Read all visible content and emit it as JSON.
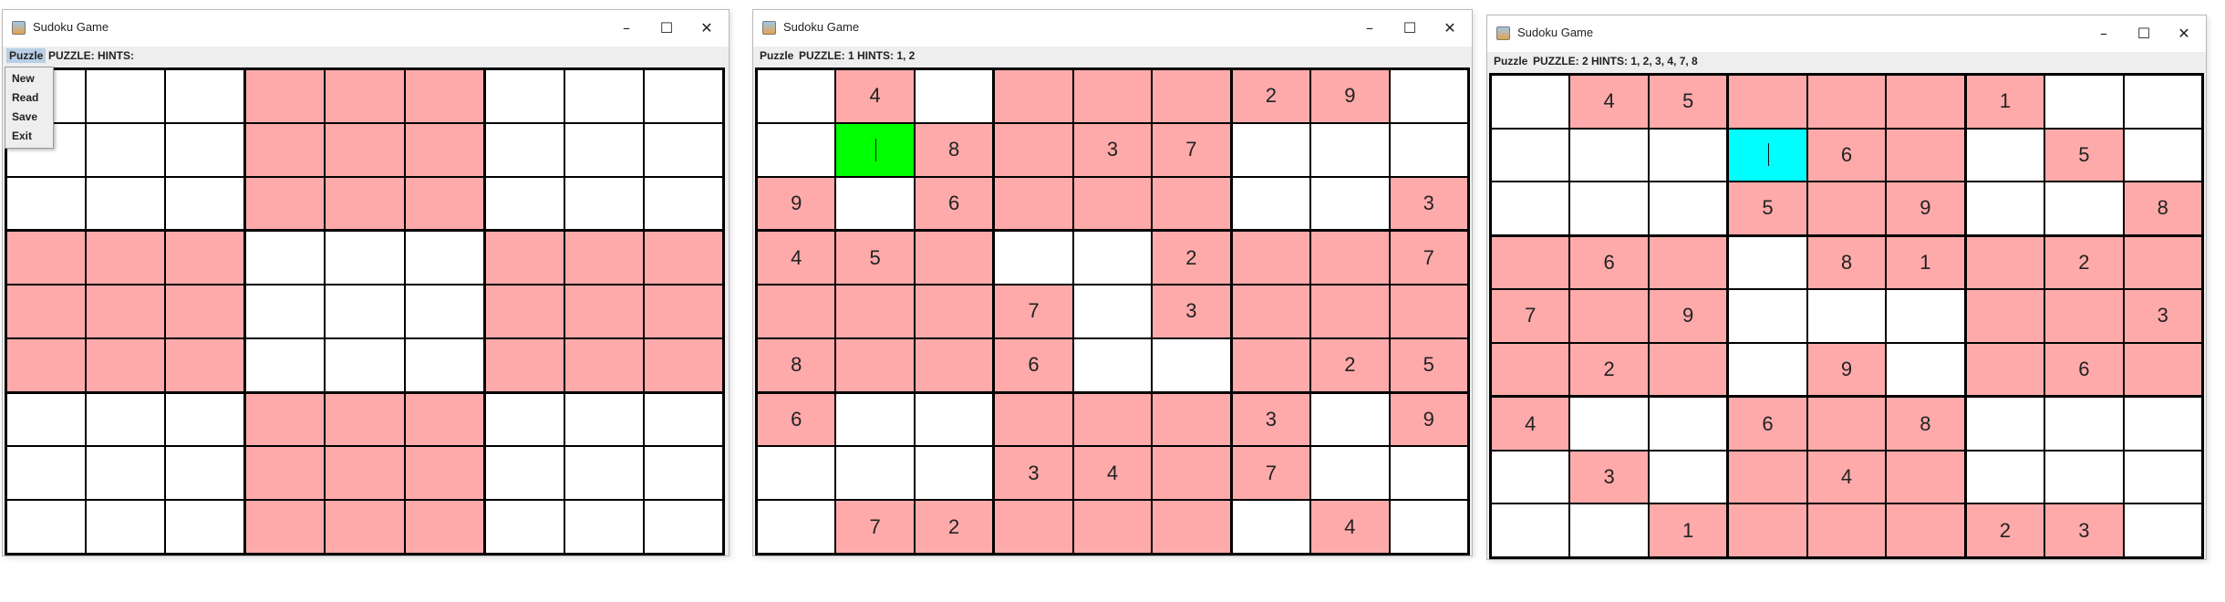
{
  "windows": [
    {
      "title": "Sudoku Game",
      "menu_label": "Puzzle",
      "info_text": "PUZZLE:  HINTS:",
      "menu_open": true,
      "menu_items": [
        "New",
        "Read",
        "Save",
        "Exit"
      ],
      "selected_cell": null,
      "selected_color": null,
      "pink_boxes": [
        1,
        3,
        5,
        7
      ],
      "grid": [
        [
          "",
          "",
          "",
          "",
          "",
          "",
          "",
          "",
          ""
        ],
        [
          "",
          "",
          "",
          "",
          "",
          "",
          "",
          "",
          ""
        ],
        [
          "",
          "",
          "",
          "",
          "",
          "",
          "",
          "",
          ""
        ],
        [
          "",
          "",
          "",
          "",
          "",
          "",
          "",
          "",
          ""
        ],
        [
          "",
          "",
          "",
          "",
          "",
          "",
          "",
          "",
          ""
        ],
        [
          "",
          "",
          "",
          "",
          "",
          "",
          "",
          "",
          ""
        ],
        [
          "",
          "",
          "",
          "",
          "",
          "",
          "",
          "",
          ""
        ],
        [
          "",
          "",
          "",
          "",
          "",
          "",
          "",
          "",
          ""
        ],
        [
          "",
          "",
          "",
          "",
          "",
          "",
          "",
          "",
          ""
        ]
      ]
    },
    {
      "title": "Sudoku Game",
      "menu_label": "Puzzle",
      "info_text": "PUZZLE: 1 HINTS: 1, 2",
      "menu_open": false,
      "menu_items": [],
      "selected_cell": [
        1,
        1
      ],
      "selected_color": "#00ff00",
      "pink_cells": [
        [
          0,
          1
        ],
        [
          0,
          3
        ],
        [
          0,
          4
        ],
        [
          0,
          5
        ],
        [
          0,
          6
        ],
        [
          0,
          7
        ],
        [
          1,
          2
        ],
        [
          1,
          3
        ],
        [
          1,
          4
        ],
        [
          1,
          5
        ],
        [
          2,
          0
        ],
        [
          2,
          2
        ],
        [
          2,
          3
        ],
        [
          2,
          4
        ],
        [
          2,
          5
        ],
        [
          2,
          8
        ],
        [
          3,
          0
        ],
        [
          3,
          1
        ],
        [
          3,
          2
        ],
        [
          3,
          5
        ],
        [
          3,
          6
        ],
        [
          3,
          7
        ],
        [
          3,
          8
        ],
        [
          4,
          0
        ],
        [
          4,
          1
        ],
        [
          4,
          2
        ],
        [
          4,
          3
        ],
        [
          4,
          5
        ],
        [
          4,
          6
        ],
        [
          4,
          7
        ],
        [
          4,
          8
        ],
        [
          5,
          0
        ],
        [
          5,
          1
        ],
        [
          5,
          2
        ],
        [
          5,
          3
        ],
        [
          5,
          6
        ],
        [
          5,
          7
        ],
        [
          5,
          8
        ],
        [
          6,
          0
        ],
        [
          6,
          3
        ],
        [
          6,
          4
        ],
        [
          6,
          5
        ],
        [
          6,
          6
        ],
        [
          6,
          8
        ],
        [
          7,
          3
        ],
        [
          7,
          4
        ],
        [
          7,
          5
        ],
        [
          7,
          6
        ],
        [
          8,
          1
        ],
        [
          8,
          2
        ],
        [
          8,
          3
        ],
        [
          8,
          4
        ],
        [
          8,
          5
        ],
        [
          8,
          7
        ]
      ],
      "grid": [
        [
          "",
          "4",
          "",
          "",
          "",
          "",
          "2",
          "9",
          ""
        ],
        [
          "",
          "",
          "8",
          "",
          "3",
          "7",
          "",
          "",
          ""
        ],
        [
          "9",
          "",
          "6",
          "",
          "",
          "",
          "",
          "",
          "3"
        ],
        [
          "4",
          "5",
          "",
          "",
          "",
          "2",
          "",
          "",
          "7"
        ],
        [
          "",
          "",
          "",
          "7",
          "",
          "3",
          "",
          "",
          ""
        ],
        [
          "8",
          "",
          "",
          "6",
          "",
          "",
          "",
          "2",
          "5"
        ],
        [
          "6",
          "",
          "",
          "",
          "",
          "",
          "3",
          "",
          "9"
        ],
        [
          "",
          "",
          "",
          "3",
          "4",
          "",
          "7",
          "",
          ""
        ],
        [
          "",
          "7",
          "2",
          "",
          "",
          "",
          "",
          "4",
          ""
        ]
      ]
    },
    {
      "title": "Sudoku Game",
      "menu_label": "Puzzle",
      "info_text": "PUZZLE: 2 HINTS: 1, 2, 3, 4, 7, 8",
      "menu_open": false,
      "menu_items": [],
      "selected_cell": [
        1,
        3
      ],
      "selected_color": "#00ffff",
      "pink_cells": [
        [
          0,
          1
        ],
        [
          0,
          2
        ],
        [
          0,
          3
        ],
        [
          0,
          4
        ],
        [
          0,
          5
        ],
        [
          0,
          6
        ],
        [
          1,
          4
        ],
        [
          1,
          5
        ],
        [
          1,
          7
        ],
        [
          2,
          3
        ],
        [
          2,
          4
        ],
        [
          2,
          5
        ],
        [
          2,
          8
        ],
        [
          3,
          0
        ],
        [
          3,
          1
        ],
        [
          3,
          2
        ],
        [
          3,
          4
        ],
        [
          3,
          5
        ],
        [
          3,
          6
        ],
        [
          3,
          7
        ],
        [
          3,
          8
        ],
        [
          4,
          0
        ],
        [
          4,
          1
        ],
        [
          4,
          2
        ],
        [
          4,
          6
        ],
        [
          4,
          7
        ],
        [
          4,
          8
        ],
        [
          5,
          0
        ],
        [
          5,
          1
        ],
        [
          5,
          2
        ],
        [
          5,
          4
        ],
        [
          5,
          6
        ],
        [
          5,
          7
        ],
        [
          5,
          8
        ],
        [
          6,
          0
        ],
        [
          6,
          3
        ],
        [
          6,
          4
        ],
        [
          6,
          5
        ],
        [
          7,
          1
        ],
        [
          7,
          3
        ],
        [
          7,
          4
        ],
        [
          7,
          5
        ],
        [
          8,
          2
        ],
        [
          8,
          3
        ],
        [
          8,
          4
        ],
        [
          8,
          5
        ],
        [
          8,
          6
        ],
        [
          8,
          7
        ]
      ],
      "grid": [
        [
          "",
          "4",
          "5",
          "",
          "",
          "",
          "1",
          "",
          ""
        ],
        [
          "",
          "",
          "",
          "",
          "6",
          "",
          "",
          "5",
          ""
        ],
        [
          "",
          "",
          "",
          "5",
          "",
          "9",
          "",
          "",
          "8"
        ],
        [
          "",
          "6",
          "",
          "",
          "8",
          "1",
          "",
          "2",
          ""
        ],
        [
          "7",
          "",
          "9",
          "",
          "",
          "",
          "",
          "",
          "3"
        ],
        [
          "",
          "2",
          "",
          "",
          "9",
          "",
          "",
          "6",
          ""
        ],
        [
          "4",
          "",
          "",
          "6",
          "",
          "8",
          "",
          "",
          ""
        ],
        [
          "",
          "3",
          "",
          "",
          "4",
          "",
          "",
          "",
          ""
        ],
        [
          "",
          "",
          "1",
          "",
          "",
          "",
          "2",
          "3",
          ""
        ]
      ]
    }
  ]
}
